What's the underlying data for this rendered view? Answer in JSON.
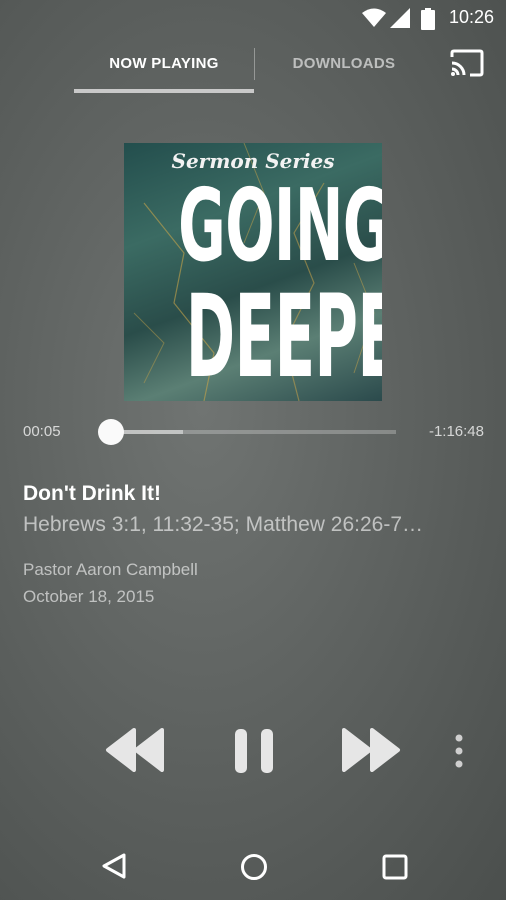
{
  "status_bar": {
    "time": "10:26"
  },
  "tabs": [
    {
      "label": "NOW PLAYING",
      "selected": true
    },
    {
      "label": "DOWNLOADS",
      "selected": false
    }
  ],
  "album_art": {
    "series_label": "Sermon Series",
    "title_line1": "GOING",
    "title_line2": "DEEPER"
  },
  "player": {
    "elapsed": "00:05",
    "remaining": "-1:16:48",
    "buffered_fraction": 0.25
  },
  "track": {
    "title": "Don't Drink It!",
    "scripture": "Hebrews 3:1, 11:32-35; Matthew 26:26-7…",
    "speaker": "Pastor Aaron Campbell",
    "date": "October 18, 2015"
  },
  "icons": {
    "status": [
      "wifi-icon",
      "signal-icon",
      "battery-icon"
    ],
    "controls": [
      "rewind-icon",
      "pause-icon",
      "fast-forward-icon",
      "more-options-icon"
    ],
    "nav": [
      "back-icon",
      "home-icon",
      "recents-icon"
    ],
    "cast": "cast-icon"
  },
  "colors": {
    "background": "#5f6361",
    "accent": "#ffffff"
  }
}
